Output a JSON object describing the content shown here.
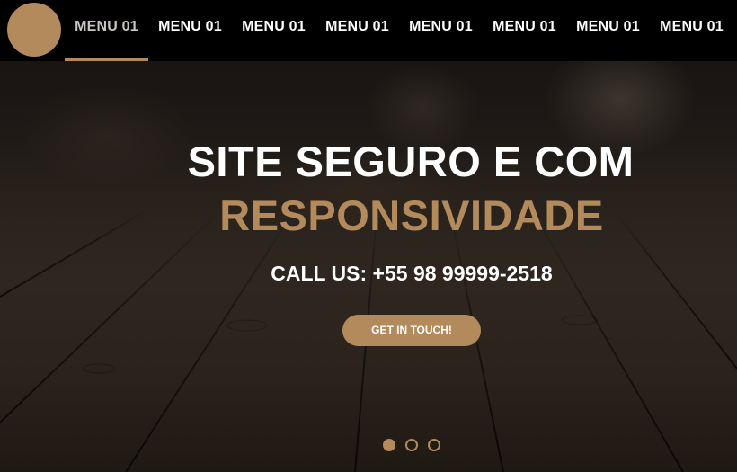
{
  "nav": {
    "logo": "brand-logo",
    "items": [
      {
        "label": "MENU 01",
        "active": true
      },
      {
        "label": "MENU 01",
        "active": false
      },
      {
        "label": "MENU 01",
        "active": false
      },
      {
        "label": "MENU 01",
        "active": false
      },
      {
        "label": "MENU 01",
        "active": false
      },
      {
        "label": "MENU 01",
        "active": false
      },
      {
        "label": "MENU 01",
        "active": false
      },
      {
        "label": "MENU 01",
        "active": false
      }
    ]
  },
  "hero": {
    "headline_line1": "SITE SEGURO E COM",
    "headline_line2": "RESPONSIVIDADE",
    "phone": "CALL US: +55 98 99999-2518",
    "cta_label": "GET IN TOUCH!"
  },
  "carousel": {
    "slide_count": 3,
    "active_index": 0
  },
  "colors": {
    "accent": "#b28a5c",
    "nav_background": "#000000",
    "text_primary": "#ffffff",
    "menu_active_text": "#c9c5c0"
  }
}
